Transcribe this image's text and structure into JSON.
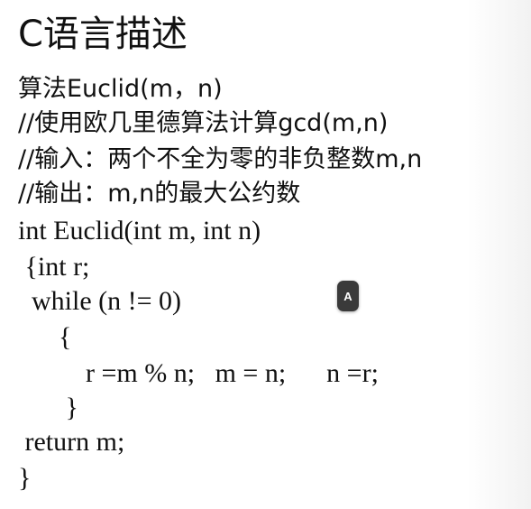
{
  "slide": {
    "title": "C语言描述",
    "description": [
      "算法Euclid(m，n)",
      "//使用欧几里德算法计算gcd(m,n)",
      "//输入：两个不全为零的非负整数m,n",
      "//输出：m,n的最大公约数"
    ],
    "code": [
      "int Euclid(int m, int n)",
      " {int r;",
      "  while (n != 0)",
      "      {",
      "          r =m % n;   m = n;      n =r;",
      "       }",
      " return m;",
      "}"
    ]
  },
  "marker": {
    "label": "A"
  }
}
